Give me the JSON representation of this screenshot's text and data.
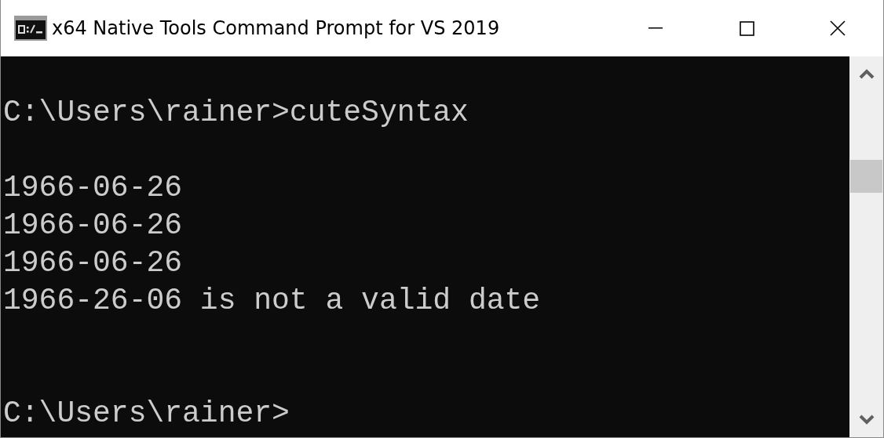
{
  "window": {
    "title": "x64 Native Tools Command Prompt for VS 2019"
  },
  "console": {
    "lines": [
      {
        "kind": "blank"
      },
      {
        "kind": "text",
        "text": "C:\\Users\\rainer>cuteSyntax"
      },
      {
        "kind": "blank"
      },
      {
        "kind": "text",
        "text": "1966-06-26"
      },
      {
        "kind": "text",
        "text": "1966-06-26"
      },
      {
        "kind": "text",
        "text": "1966-06-26"
      },
      {
        "kind": "text",
        "text": "1966-26-06 is not a valid date"
      },
      {
        "kind": "blank"
      },
      {
        "kind": "blank"
      },
      {
        "kind": "text",
        "text": "C:\\Users\\rainer>"
      }
    ]
  }
}
